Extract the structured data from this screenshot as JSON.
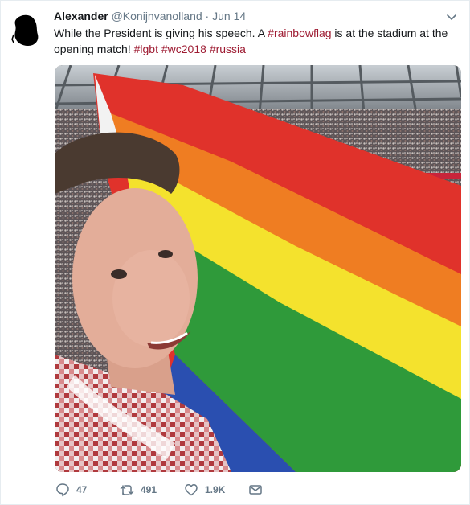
{
  "tweet": {
    "author_name": "Alexander",
    "author_handle": "@Konijnvanolland",
    "separator": " · ",
    "date": "Jun 14",
    "text_segments": [
      {
        "type": "text",
        "value": "While the President is giving his speech. A "
      },
      {
        "type": "hashtag",
        "value": "#rainbowflag"
      },
      {
        "type": "text",
        "value": " is at the stadium at the opening match! "
      },
      {
        "type": "hashtag",
        "value": "#lgbt"
      },
      {
        "type": "text",
        "value": " "
      },
      {
        "type": "hashtag",
        "value": "#wc2018"
      },
      {
        "type": "text",
        "value": " "
      },
      {
        "type": "hashtag",
        "value": "#russia"
      }
    ],
    "media_description_icon": "photo",
    "actions": {
      "reply": {
        "icon": "reply-icon",
        "count": "47"
      },
      "retweet": {
        "icon": "retweet-icon",
        "count": "491"
      },
      "like": {
        "icon": "heart-icon",
        "count": "1.9K"
      },
      "message": {
        "icon": "envelope-icon"
      }
    },
    "colors": {
      "hashtag": "#9e1b32",
      "secondary": "#657786",
      "primary": "#14171a"
    }
  }
}
